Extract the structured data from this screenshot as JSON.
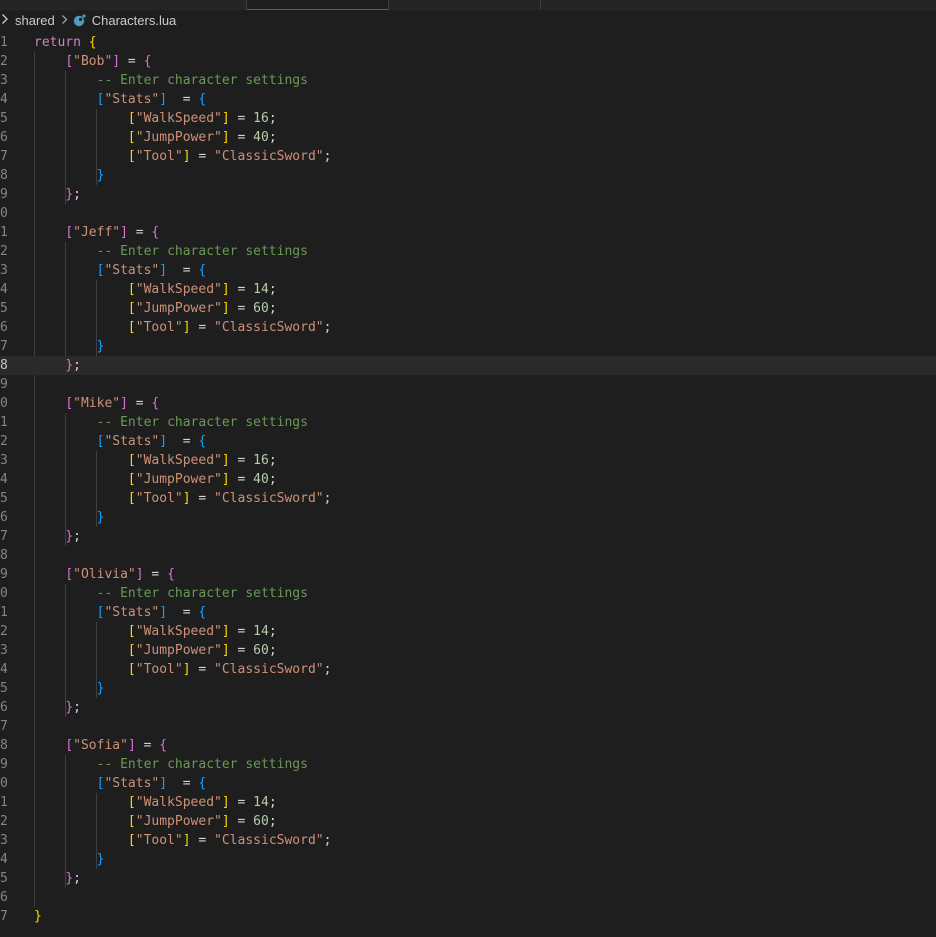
{
  "breadcrumb": {
    "folder": "shared",
    "file": "Characters.lua"
  },
  "editor": {
    "language": "lua",
    "current_line": 18,
    "line_numbers": [
      "1",
      "2",
      "3",
      "4",
      "5",
      "6",
      "7",
      "8",
      "9",
      "0",
      "1",
      "2",
      "3",
      "4",
      "5",
      "6",
      "7",
      "8",
      "9",
      "0",
      "1",
      "2",
      "3",
      "4",
      "5",
      "6",
      "7",
      "8",
      "9",
      "0",
      "1",
      "2",
      "3",
      "4",
      "5",
      "6",
      "7",
      "8",
      "9",
      "0",
      "1",
      "2",
      "3",
      "4",
      "5",
      "6",
      "7"
    ],
    "keyword_return": "return",
    "comment": "-- Enter character settings",
    "stats_key": "\"Stats\"",
    "walkspeed_key": "\"WalkSpeed\"",
    "jumppower_key": "\"JumpPower\"",
    "tool_key": "\"Tool\"",
    "tool_value": "\"ClassicSword\"",
    "characters": [
      {
        "name": "\"Bob\"",
        "walkspeed": "16",
        "jumppower": "40"
      },
      {
        "name": "\"Jeff\"",
        "walkspeed": "14",
        "jumppower": "60"
      },
      {
        "name": "\"Mike\"",
        "walkspeed": "16",
        "jumppower": "40"
      },
      {
        "name": "\"Olivia\"",
        "walkspeed": "14",
        "jumppower": "60"
      },
      {
        "name": "\"Sofia\"",
        "walkspeed": "14",
        "jumppower": "60"
      }
    ]
  },
  "colors": {
    "background": "#1e1e1e",
    "keyword": "#c586c0",
    "bracket_level1": "#ffd700",
    "bracket_level2": "#da70d6",
    "bracket_level3": "#179fff",
    "string": "#ce9178",
    "number": "#b5cea8",
    "comment": "#6a9955",
    "accent": "#007acc"
  },
  "icons": {
    "breadcrumb_chevron": "chevron-right-icon",
    "file_type": "lua-file-icon"
  }
}
